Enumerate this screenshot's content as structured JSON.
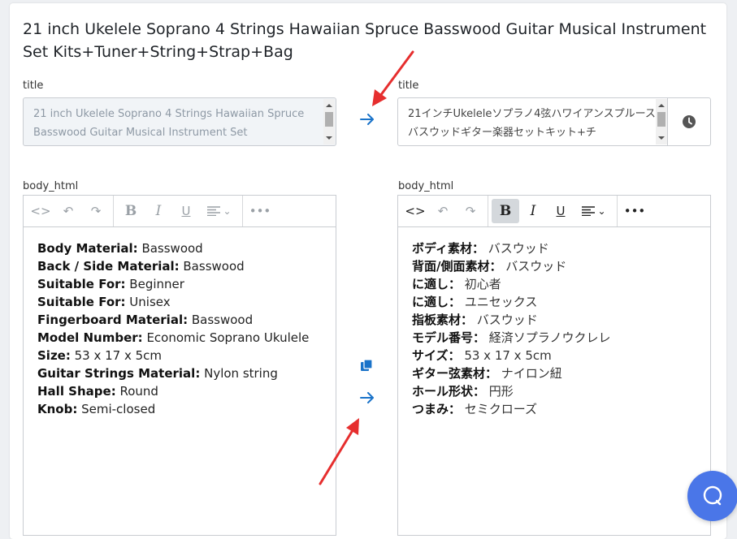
{
  "product": {
    "title": "21 inch Ukelele Soprano 4 Strings Hawaiian Spruce Basswood Guitar Musical Instrument Set Kits+Tuner+String+Strap+Bag"
  },
  "source": {
    "title_label": "title",
    "title_value": "21 inch Ukelele Soprano 4 Strings Hawaiian Spruce Basswood Guitar Musical Instrument Set",
    "body_label": "body_html",
    "body_rows": [
      {
        "key": "Body Material:",
        "value": " Basswood"
      },
      {
        "key": "Back / Side Material:",
        "value": " Basswood"
      },
      {
        "key": "Suitable For:",
        "value": " Beginner"
      },
      {
        "key": "Suitable For:",
        "value": " Unisex"
      },
      {
        "key": "Fingerboard Material:",
        "value": " Basswood"
      },
      {
        "key": "Model Number:",
        "value": " Economic Soprano Ukulele"
      },
      {
        "key": "Size:",
        "value": " 53 x 17 x 5cm"
      },
      {
        "key": "Guitar Strings Material:",
        "value": " Nylon string"
      },
      {
        "key": "Hall Shape:",
        "value": " Round"
      },
      {
        "key": "Knob:",
        "value": " Semi-closed"
      }
    ]
  },
  "translation": {
    "title_label": "title",
    "title_value": "21インチUkeleleソプラノ4弦ハワイアンスプルースバスウッドギター楽器セットキット+チ",
    "body_label": "body_html",
    "body_rows": [
      {
        "key": "ボディ素材：",
        "value": " バスウッド"
      },
      {
        "key": "背面/側面素材：",
        "value": " バスウッド"
      },
      {
        "key": "に適し：",
        "value": " 初心者"
      },
      {
        "key": "に適し：",
        "value": " ユニセックス"
      },
      {
        "key": "指板素材：",
        "value": " バスウッド"
      },
      {
        "key": "モデル番号：",
        "value": " 経済ソプラノウクレレ"
      },
      {
        "key": "サイズ：",
        "value": " 53 x 17 x 5cm"
      },
      {
        "key": "ギター弦素材：",
        "value": " ナイロン紐"
      },
      {
        "key": "ホール形状：",
        "value": " 円形"
      },
      {
        "key": "つまみ：",
        "value": " セミクローズ"
      }
    ]
  },
  "toolbar": {
    "code": "<>",
    "undo": "↶",
    "redo": "↷",
    "bold": "B",
    "italic": "I",
    "underline": "U",
    "align_caret": "⌄",
    "more": "•••"
  },
  "icons": {
    "translate_arrow": "arrow-right-icon",
    "copy": "copy-icon",
    "history": "clock-icon",
    "chat": "chat-icon"
  },
  "colors": {
    "accent_blue": "#1a73c9",
    "annotation_red": "#e62e2e",
    "chat_button": "#4a76e8"
  }
}
